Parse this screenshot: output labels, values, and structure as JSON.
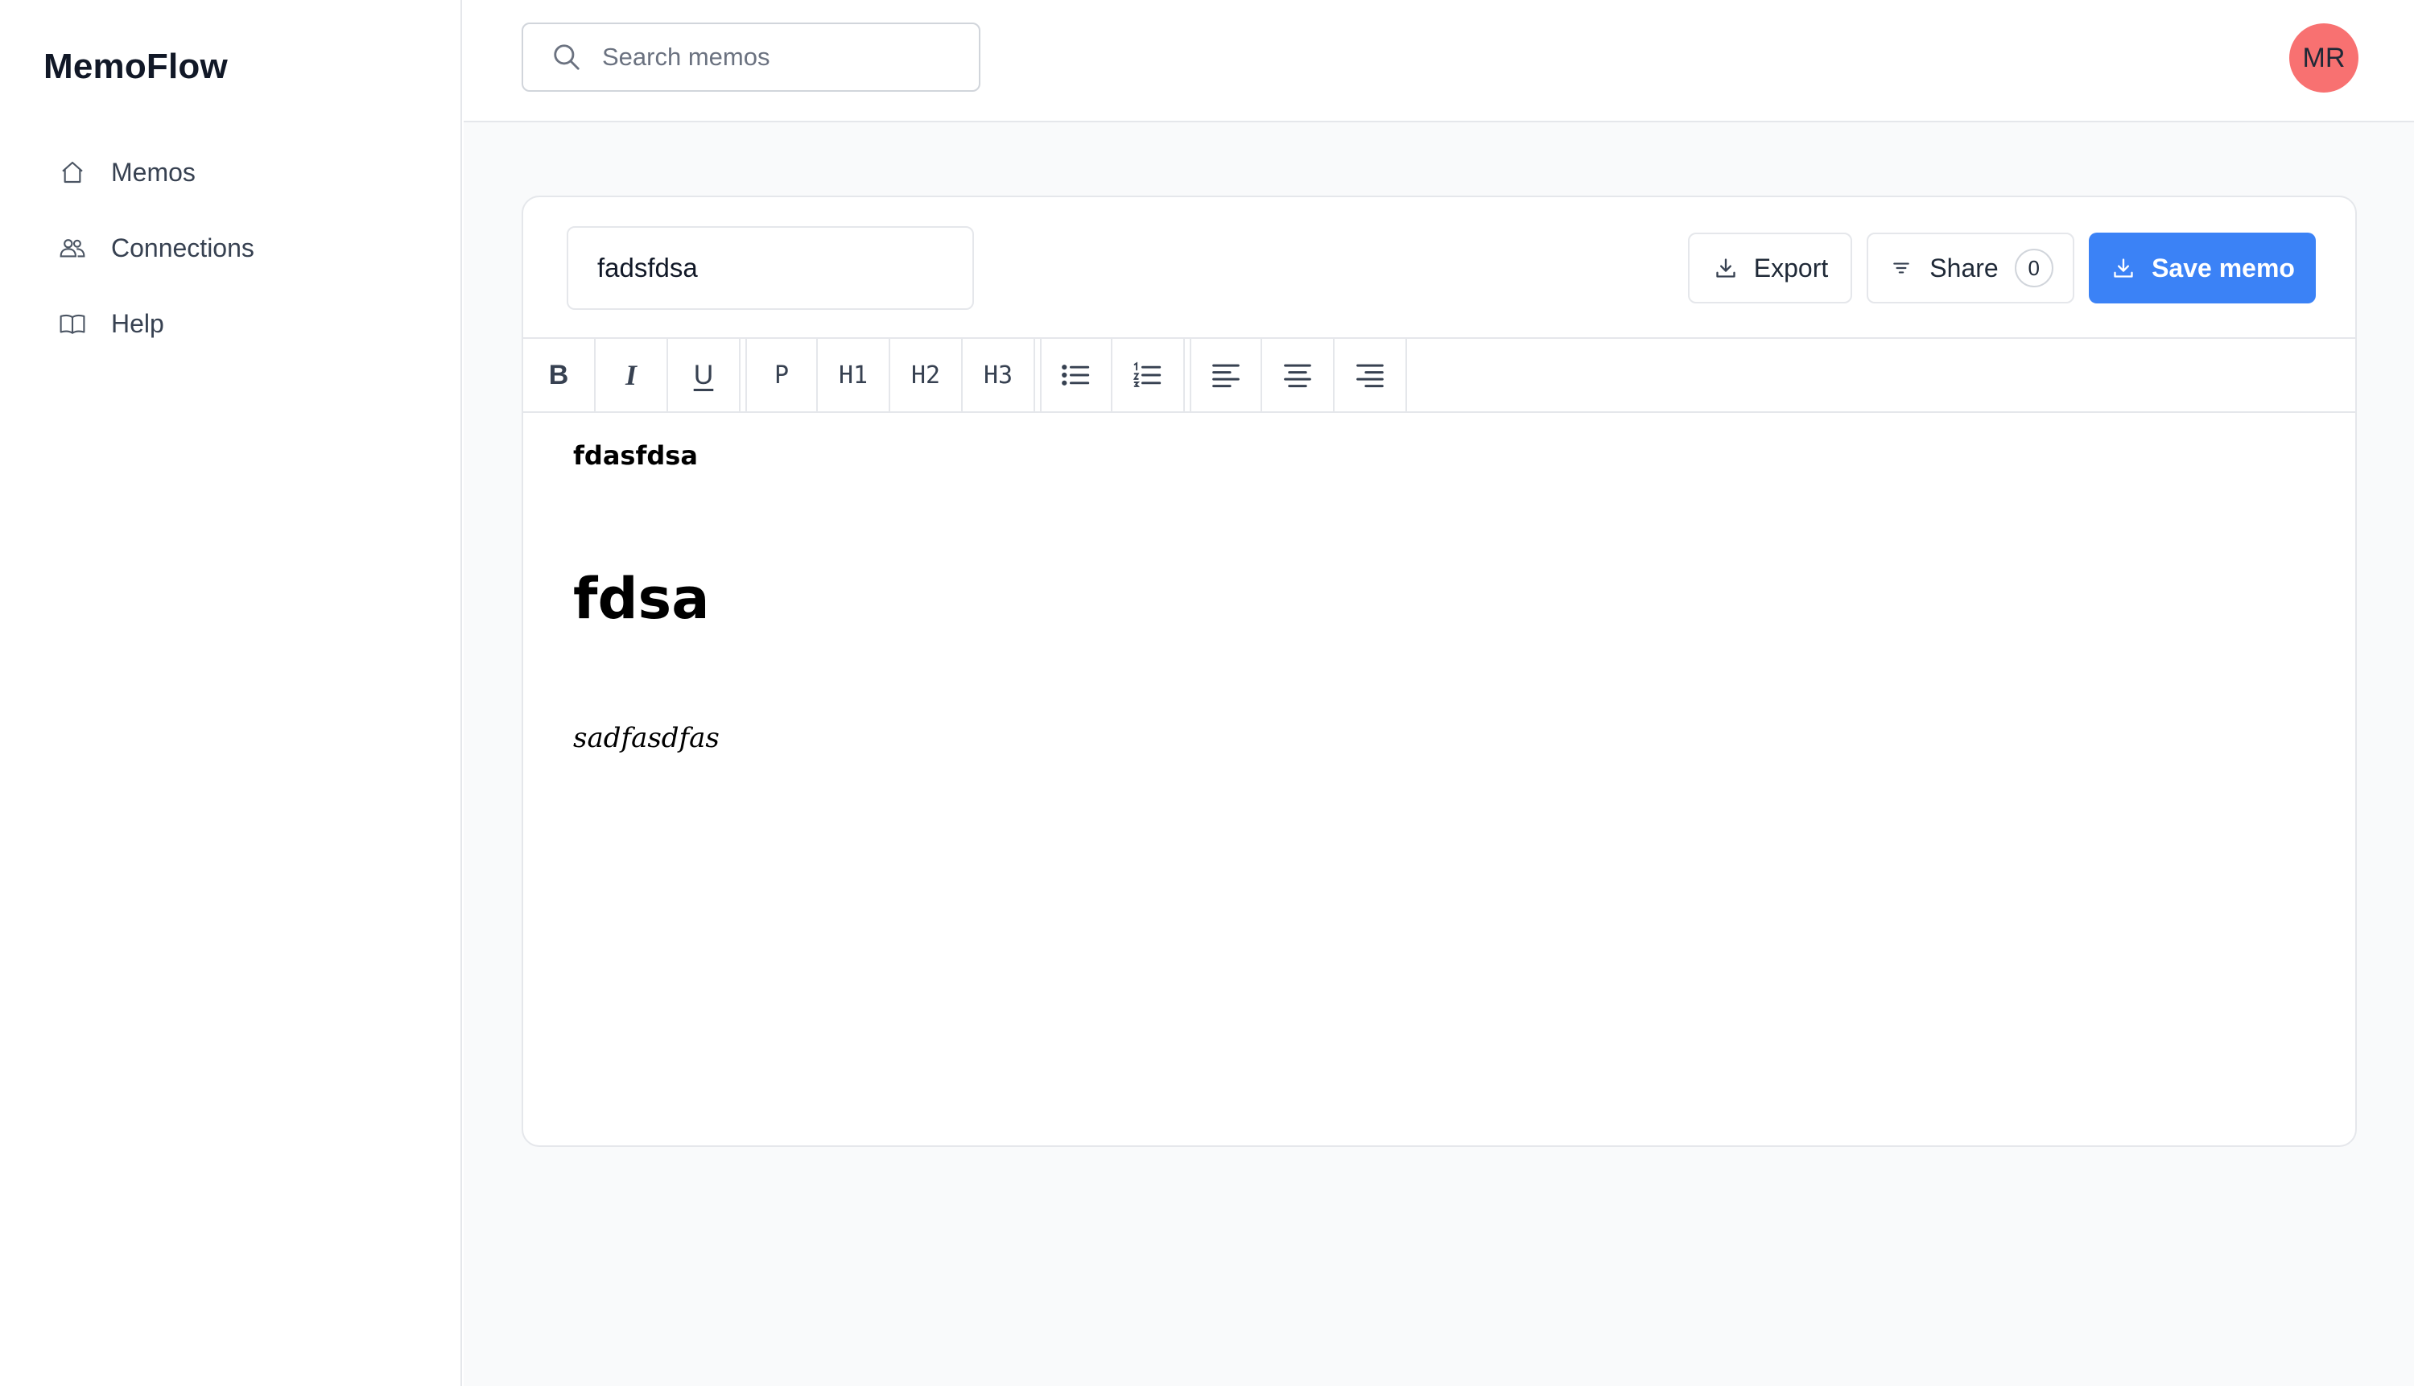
{
  "app": {
    "name": "MemoFlow"
  },
  "sidebar": {
    "items": [
      {
        "label": "Memos",
        "icon": "home-icon"
      },
      {
        "label": "Connections",
        "icon": "users-icon"
      },
      {
        "label": "Help",
        "icon": "book-icon"
      }
    ]
  },
  "header": {
    "search": {
      "placeholder": "Search memos",
      "value": ""
    },
    "avatar_initials": "MR",
    "avatar_color": "#f87171"
  },
  "memo": {
    "title_value": "fadsfdsa",
    "actions": {
      "export_label": "Export",
      "share_label": "Share",
      "share_count": "0",
      "save_label": "Save memo",
      "save_color": "#3b82f6"
    },
    "toolbar": {
      "bold": "B",
      "italic": "I",
      "underline": "U",
      "paragraph": "P",
      "h1": "H1",
      "h2": "H2",
      "h3": "H3"
    },
    "content": {
      "bold_paragraph": "fdasfdsa",
      "heading": "fdsa",
      "italic_paragraph": "sadfasdfas"
    }
  }
}
